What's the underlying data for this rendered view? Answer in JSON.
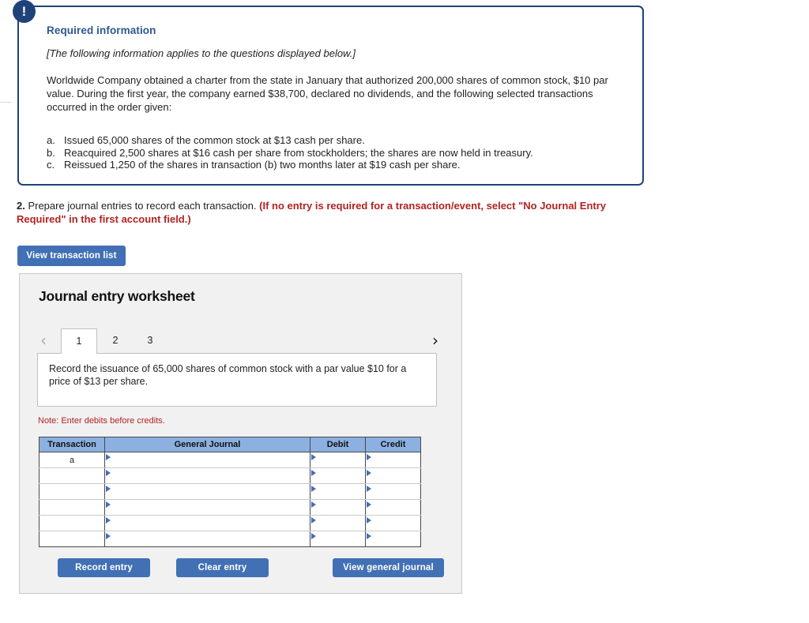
{
  "required_info": {
    "badge_glyph": "!",
    "title": "Required information",
    "italic_note": "[The following information applies to the questions displayed below.]",
    "paragraph": "Worldwide Company obtained a charter from the state in January that authorized 200,000 shares of common stock, $10 par value. During the first year, the company earned $38,700, declared no dividends, and the following selected transactions occurred in the order given:",
    "items": [
      {
        "marker": "a.",
        "text": "Issued 65,000 shares of the common stock at $13 cash per share."
      },
      {
        "marker": "b.",
        "text": "Reacquired 2,500 shares at $16 cash per share from stockholders; the shares are now held in treasury."
      },
      {
        "marker": "c.",
        "text": "Reissued 1,250 of the shares in transaction (b) two months later at $19 cash per share."
      }
    ]
  },
  "question": {
    "number": "2.",
    "text": " Prepare journal entries to record each transaction. ",
    "hint": "(If no entry is required for a transaction/event, select \"No Journal Entry Required\" in the first account field.)"
  },
  "buttons": {
    "view_transaction_list": "View transaction list",
    "record_entry": "Record entry",
    "clear_entry": "Clear entry",
    "view_general_journal": "View general journal"
  },
  "worksheet": {
    "title": "Journal entry worksheet",
    "prev_chevron": "‹",
    "next_chevron": "›",
    "tabs": [
      {
        "label": "1",
        "active": true
      },
      {
        "label": "2",
        "active": false
      },
      {
        "label": "3",
        "active": false
      }
    ],
    "description": "Record the issuance of 65,000 shares of common stock with a par value $10 for a price of $13 per share.",
    "note": "Note: Enter debits before credits.",
    "table": {
      "headers": [
        "Transaction",
        "General Journal",
        "Debit",
        "Credit"
      ],
      "rows": [
        {
          "transaction": "a",
          "general_journal": "",
          "debit": "",
          "credit": ""
        },
        {
          "transaction": "",
          "general_journal": "",
          "debit": "",
          "credit": ""
        },
        {
          "transaction": "",
          "general_journal": "",
          "debit": "",
          "credit": ""
        },
        {
          "transaction": "",
          "general_journal": "",
          "debit": "",
          "credit": ""
        },
        {
          "transaction": "",
          "general_journal": "",
          "debit": "",
          "credit": ""
        },
        {
          "transaction": "",
          "general_journal": "",
          "debit": "",
          "credit": ""
        }
      ]
    }
  },
  "colors": {
    "callout_border": "#1f4379",
    "callout_title": "#2d5891",
    "button_blue": "#4270b5",
    "hint_red": "#b42222",
    "table_header_blue": "#8cb0e0",
    "panel_gray": "#f1f1f1"
  }
}
